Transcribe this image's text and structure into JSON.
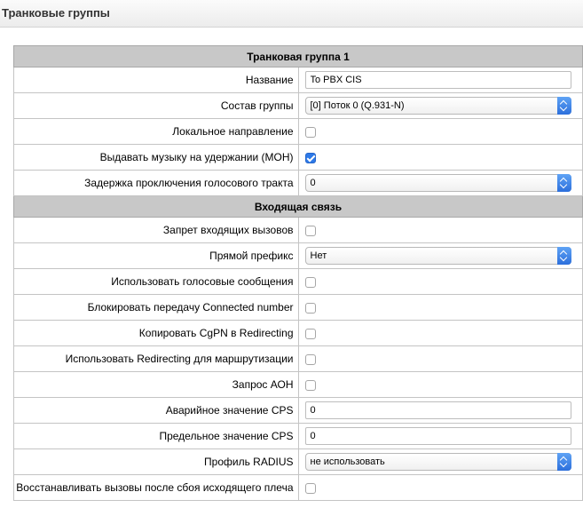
{
  "header": {
    "title": "Транковые группы"
  },
  "sections": {
    "trunk_group": "Транковая группа 1",
    "incoming": "Входящая связь"
  },
  "fields": {
    "name": {
      "label": "Название",
      "value": "To PBX CIS"
    },
    "group": {
      "label": "Состав группы",
      "value": "[0] Поток 0 (Q.931-N)"
    },
    "local_direction": {
      "label": "Локальное направление",
      "checked": false
    },
    "moh": {
      "label": "Выдавать музыку на удержании (MOH)",
      "checked": true
    },
    "voice_delay": {
      "label": "Задержка проключения голосового тракта",
      "value": "0"
    },
    "deny_incoming": {
      "label": "Запрет входящих вызовов",
      "checked": false
    },
    "direct_prefix": {
      "label": "Прямой префикс",
      "value": "Нет"
    },
    "voice_messages": {
      "label": "Использовать голосовые сообщения",
      "checked": false
    },
    "block_connected": {
      "label": "Блокировать передачу Connected number",
      "checked": false
    },
    "copy_cgpn": {
      "label": "Копировать CgPN в Redirecting",
      "checked": false
    },
    "redirecting_routing": {
      "label": "Использовать Redirecting для маршрутизации",
      "checked": false
    },
    "aon_request": {
      "label": "Запрос АОН",
      "checked": false
    },
    "emergency_cps": {
      "label": "Аварийное значение CPS",
      "value": "0"
    },
    "limit_cps": {
      "label": "Предельное значение CPS",
      "value": "0"
    },
    "radius_profile": {
      "label": "Профиль RADIUS",
      "value": "не использовать"
    },
    "restore_calls": {
      "label": "Восстанавливать вызовы после сбоя исходящего плеча",
      "checked": false
    }
  }
}
